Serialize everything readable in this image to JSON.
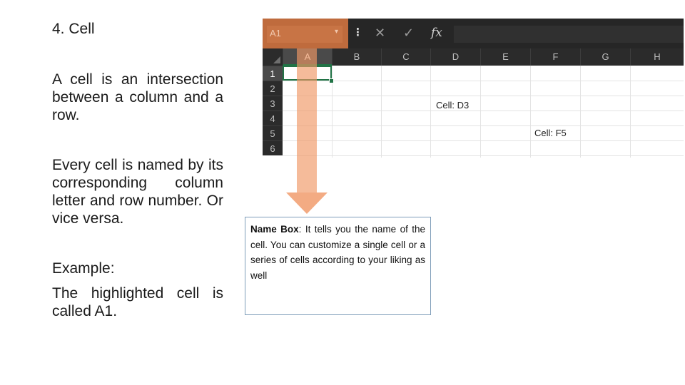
{
  "slide": {
    "title": "4. Cell",
    "p1": "A cell is an intersection between a column and a row.",
    "p2": "Every cell is named by its corresponding column letter and row number. Or vice versa.",
    "p3": "Example:",
    "p4": "The highlighted cell is called A1."
  },
  "excel": {
    "name_box_value": "A1",
    "name_box_caret": "▾",
    "menu_dots": "⋮",
    "cancel_icon": "✕",
    "enter_icon": "✓",
    "fx_label": "fx",
    "columns": [
      "A",
      "B",
      "C",
      "D",
      "E",
      "F",
      "G",
      "H"
    ],
    "rows": [
      "1",
      "2",
      "3",
      "4",
      "5",
      "6"
    ],
    "cell_d3": "Cell: D3",
    "cell_f5": "Cell: F5"
  },
  "callout": {
    "label": "Name Box",
    "text": ": It tells you the name of the cell. You can customize a single cell or a series of cells according to your liking as well"
  },
  "colors": {
    "highlight": "#f0965f",
    "excel_dark": "#262626",
    "selection_green": "#217346"
  }
}
